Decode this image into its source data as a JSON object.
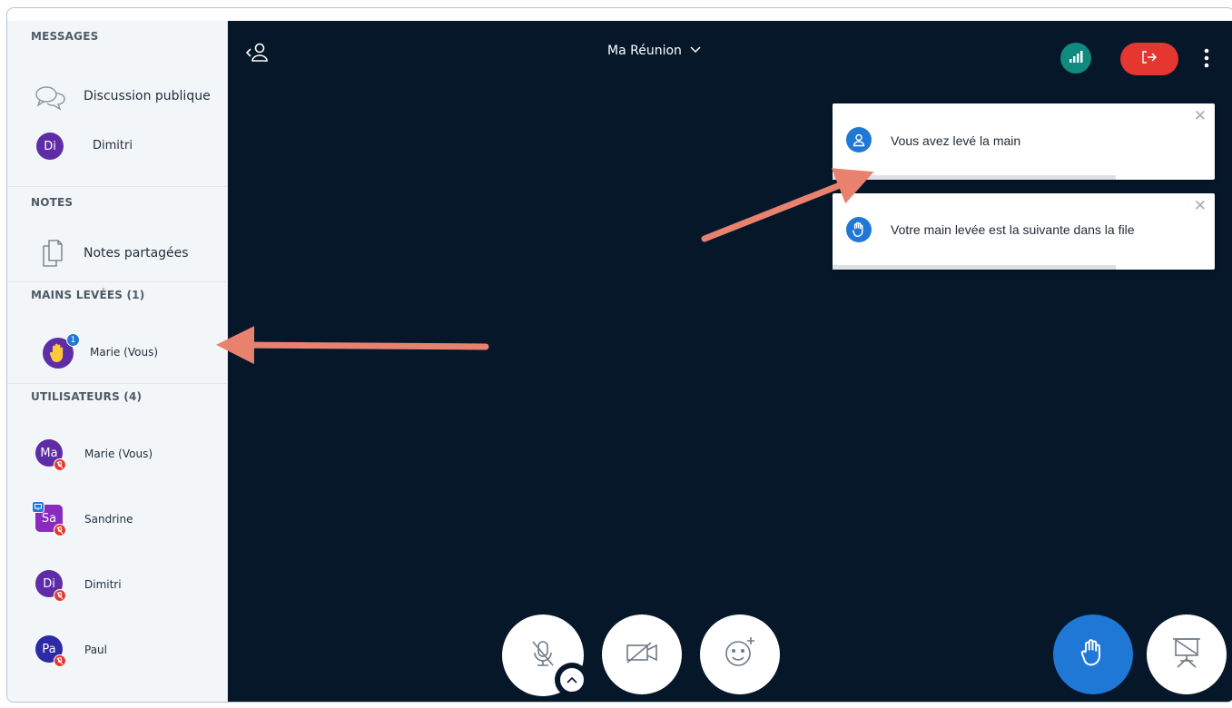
{
  "sidebar": {
    "messages": {
      "title": "MESSAGES",
      "items": [
        {
          "label": "Discussion publique",
          "icon": "chat-bubbles-icon"
        },
        {
          "label": "Dimitri",
          "initials": "Di",
          "color": "#5e2ca5"
        }
      ]
    },
    "notes": {
      "title": "NOTES",
      "items": [
        {
          "label": "Notes partagées",
          "icon": "document-icon"
        }
      ]
    },
    "raised_hands": {
      "title": "MAINS LEVÉES (1)",
      "items": [
        {
          "label": "Marie (Vous)",
          "badge": "1",
          "icon": "raised-hand-icon",
          "color": "#5e2ca5"
        }
      ]
    },
    "users": {
      "title": "UTILISATEURS (4)",
      "items": [
        {
          "label": "Marie (Vous)",
          "initials": "Ma",
          "color": "#5e2ca5"
        },
        {
          "label": "Sandrine",
          "initials": "Sa",
          "color": "#8a2bbf"
        },
        {
          "label": "Dimitri",
          "initials": "Di",
          "color": "#5e2ca5"
        },
        {
          "label": "Paul",
          "initials": "Pa",
          "color": "#2d2aa8"
        }
      ]
    }
  },
  "topbar": {
    "meeting_title": "Ma Réunion",
    "connection_color": "#0f8a7f",
    "leave_color": "#e5362f"
  },
  "toasts": [
    {
      "message": "Vous avez levé la main",
      "icon": "user-icon"
    },
    {
      "message": "Votre main levée est la suivante dans la file",
      "icon": "raised-hand-icon"
    }
  ],
  "actions": {
    "mic": "mic-muted-icon",
    "camera": "camera-off-icon",
    "reactions": "emoji-add-icon",
    "raise_hand": "raised-hand-icon",
    "presentation": "presentation-icon",
    "accent": "#1f77d6"
  }
}
